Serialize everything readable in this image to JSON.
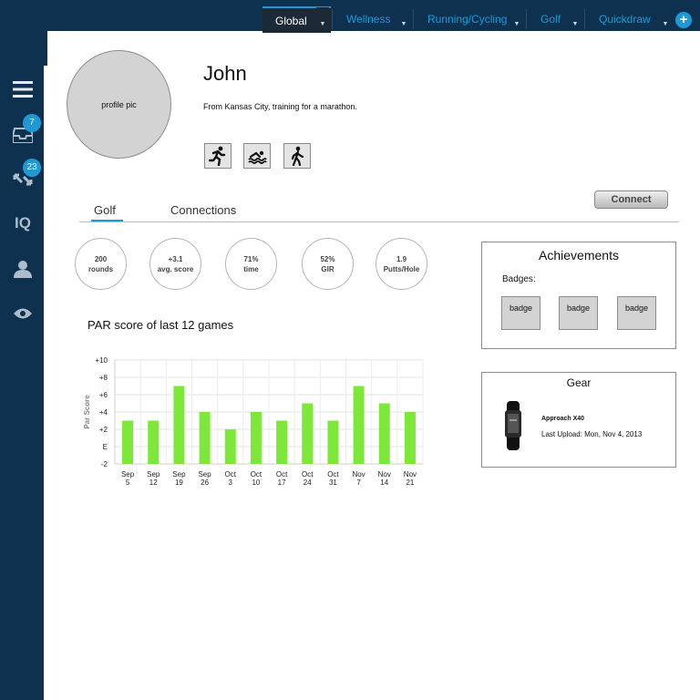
{
  "tabs": [
    {
      "label": "Global",
      "active": true
    },
    {
      "label": "Wellness",
      "active": false
    },
    {
      "label": "Running/Cycling",
      "active": false
    },
    {
      "label": "Golf",
      "active": false
    },
    {
      "label": "Quickdraw",
      "active": false
    }
  ],
  "tab_caret": "▼",
  "add_tab_label": "+",
  "sidebar": {
    "inbox_count": "7",
    "connections_count": "23",
    "iq_label": "IQ"
  },
  "profile": {
    "pic_label": "profile pic",
    "name": "John",
    "bio": "From Kansas City, training for a marathon.",
    "activities": [
      "running-icon",
      "swimming-icon",
      "walking-icon"
    ]
  },
  "connect_label": "Connect",
  "profile_tabs": [
    {
      "label": "Golf",
      "active": true
    },
    {
      "label": "Connections",
      "active": false
    }
  ],
  "stats": [
    {
      "value": "200",
      "label": "rounds"
    },
    {
      "value": "+3.1",
      "label": "avg. score"
    },
    {
      "value": "71%",
      "label": "time"
    },
    {
      "value": "52%",
      "label": "GIR"
    },
    {
      "value": "1.9",
      "label": "Putts/Hole"
    }
  ],
  "achievements": {
    "title": "Achievements",
    "badges_label": "Badges:",
    "badges": [
      "badge",
      "badge",
      "badge"
    ]
  },
  "gear": {
    "title": "Gear",
    "device_name": "Approach X40",
    "last_upload": "Last Upload: Mon, Nov 4, 2013"
  },
  "colors": {
    "nav_bg": "#0e3150",
    "accent": "#1d9ad6",
    "bar": "#7ee83a"
  },
  "chart_title": "PAR score of last 12 games",
  "chart_data": {
    "type": "bar",
    "categories": [
      "Sep 5",
      "Sep 12",
      "Sep 19",
      "Sep 26",
      "Oct 3",
      "Oct 10",
      "Oct 17",
      "Oct 24",
      "Oct 31",
      "Nov 7",
      "Nov 14",
      "Nov 21"
    ],
    "series": [
      {
        "values": [
          3,
          3,
          7,
          4,
          2,
          4,
          3,
          5,
          3,
          7,
          5,
          4
        ]
      }
    ],
    "ylabel": "Par Score",
    "ylim": [
      -2,
      10
    ],
    "yticks": [
      {
        "value": 10,
        "label": "+10"
      },
      {
        "value": 8,
        "label": "+8"
      },
      {
        "value": 6,
        "label": "+6"
      },
      {
        "value": 4,
        "label": "+4"
      },
      {
        "value": 2,
        "label": "+2"
      },
      {
        "value": 0,
        "label": "E"
      },
      {
        "value": -2,
        "label": "-2"
      }
    ],
    "grid": true,
    "baseline": -2
  }
}
